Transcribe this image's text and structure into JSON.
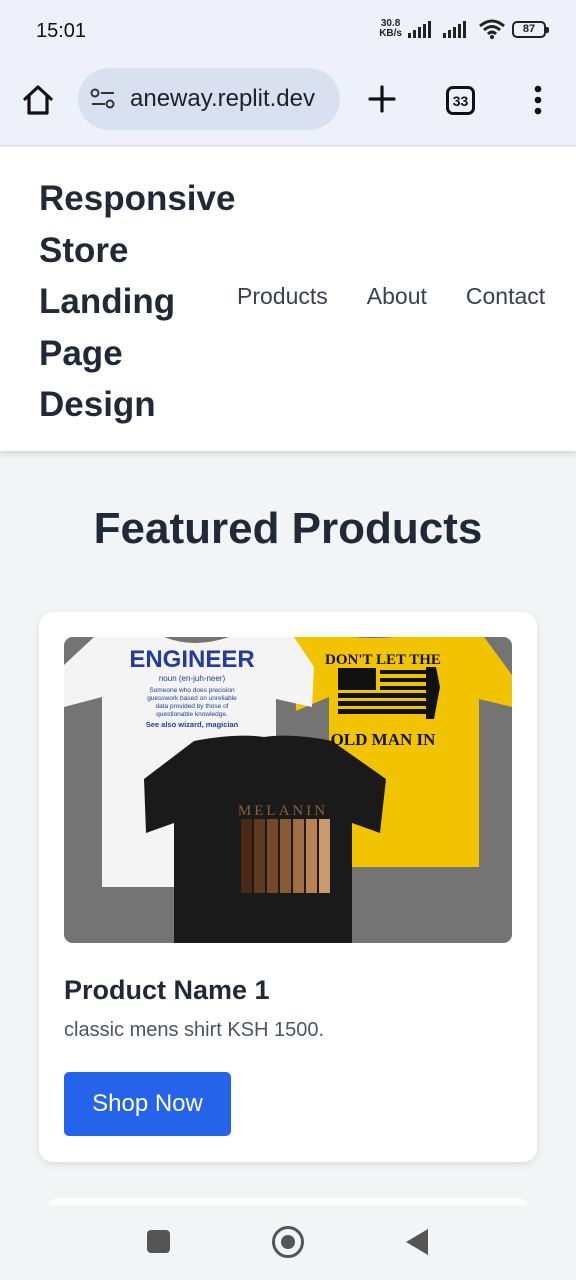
{
  "status_bar": {
    "time": "15:01",
    "speed_value": "30.8",
    "speed_unit": "KB/s",
    "battery": "87"
  },
  "browser": {
    "url": "aneway.replit.dev",
    "tab_count": "33"
  },
  "header": {
    "site_title": "Responsive Store Landing Page Design",
    "nav": [
      "Products",
      "About",
      "Contact"
    ]
  },
  "main": {
    "section_title": "Featured Products",
    "products": [
      {
        "name": "Product Name 1",
        "description": "classic mens shirt KSH 1500.",
        "button_label": "Shop Now",
        "image_text": {
          "white_title": "ENGINEER",
          "white_sub": "noun (en-juh-neer)",
          "white_line1": "Someone who does precision",
          "white_line2": "guesswork based on unreliable",
          "white_line3": "data provided by those of",
          "white_line4": "questionable knowledge.",
          "white_line5": "See also wizard, magician",
          "yellow_top": "DON'T LET THE",
          "yellow_bottom": "OLD MAN IN",
          "black_title": "MELANIN"
        }
      }
    ]
  },
  "colors": {
    "accent": "#2563eb",
    "heading": "#1f2937",
    "background": "#f3f4f6"
  }
}
